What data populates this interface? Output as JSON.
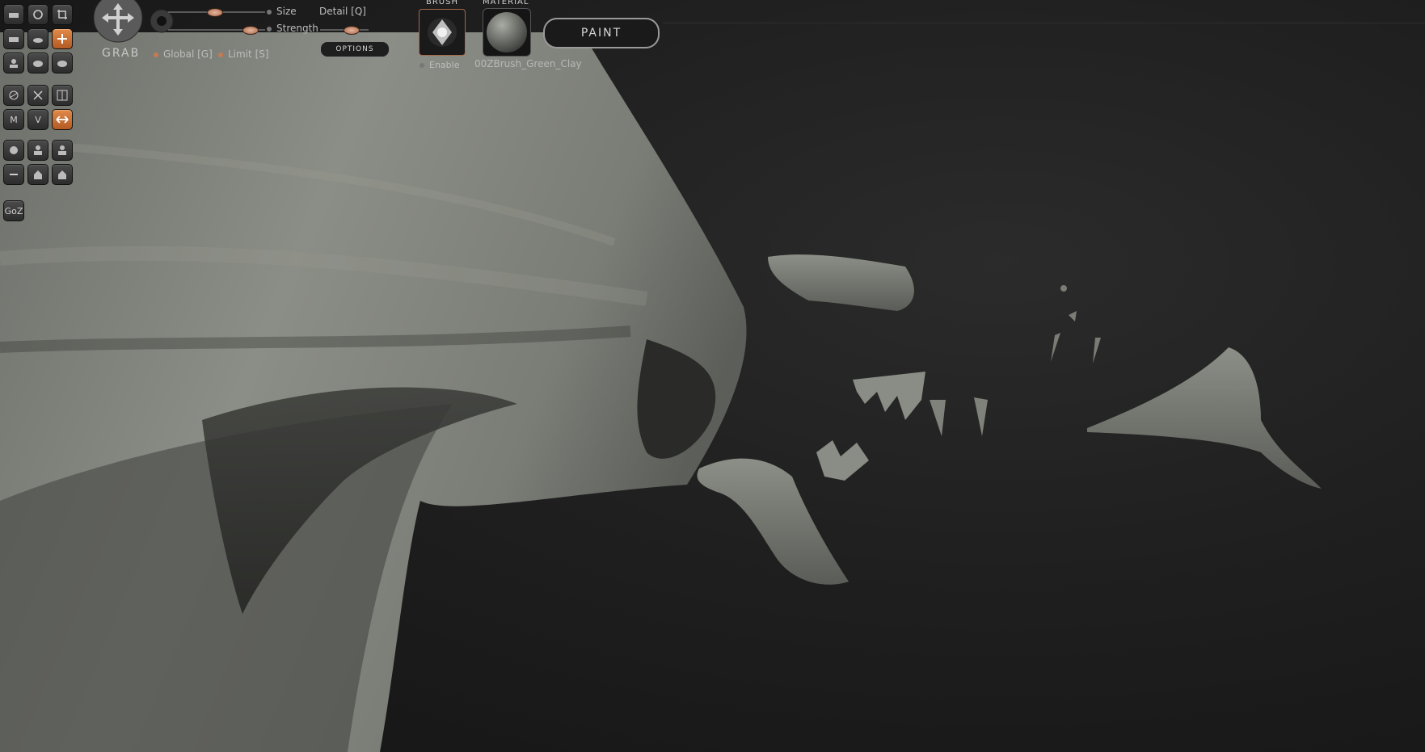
{
  "viewport": {
    "background": "#1f1f1f",
    "model_color": "#7e817a"
  },
  "toolbar_left": {
    "buttons": [
      {
        "icon": "bowl-icon"
      },
      {
        "icon": "rotate-icon"
      },
      {
        "icon": "crop-icon"
      },
      {
        "icon": "bowl-icon"
      },
      {
        "icon": "smooth-icon"
      },
      {
        "icon": "move-icon",
        "active": true
      },
      {
        "icon": "head-icon"
      },
      {
        "icon": "blob-icon"
      },
      {
        "icon": "blob-icon"
      },
      {
        "icon": "circle-line-icon"
      },
      {
        "icon": "x-icon"
      },
      {
        "icon": "grid-icon"
      },
      {
        "icon": "m-icon",
        "label": "M"
      },
      {
        "icon": "v-icon",
        "label": "V"
      },
      {
        "icon": "arrows-icon",
        "active": true
      },
      {
        "icon": "sphere-icon"
      },
      {
        "icon": "cube-sphere-icon"
      },
      {
        "icon": "cube-sphere-icon"
      },
      {
        "icon": "minus-icon"
      },
      {
        "icon": "house-icon"
      },
      {
        "icon": "house-icon"
      }
    ],
    "goz_label": "GoZ"
  },
  "topbar": {
    "tool_name": "GRAB",
    "size_label": "Size",
    "strength_label": "Strength",
    "detail_label": "Detail [Q]",
    "global_label": "Global [G]",
    "limit_label": "Limit [S]",
    "options_label": "OPTIONS",
    "brush_header": "BRUSH",
    "material_header": "MATERIAL",
    "enable_label": "Enable",
    "material_name": "00ZBrush_Green_Clay",
    "paint_label": "PAINT"
  }
}
